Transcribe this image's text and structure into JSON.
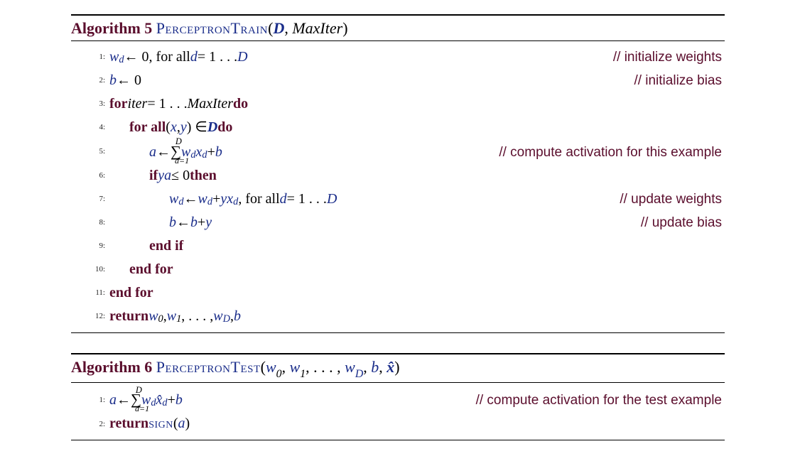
{
  "alg5": {
    "header_label": "Algorithm 5",
    "name": "PerceptronTrain",
    "params_open": "(",
    "param1": "D",
    "params_sep": ", ",
    "param2": "MaxIter",
    "params_close": ")",
    "lines": {
      "l1_no": "1:",
      "l1_code_pre": "w",
      "l1_code_sub": "d",
      "l1_code_mid": " ← 0, for all  ",
      "l1_code_d": "d",
      "l1_code_eq": " = 1 . . . ",
      "l1_code_D": "D",
      "l1_comment": "// initialize weights",
      "l2_no": "2:",
      "l2_code_b": "b",
      "l2_code_rest": " ← 0",
      "l2_comment": "// initialize bias",
      "l3_no": "3:",
      "l3_for": "for",
      "l3_iter": " iter",
      "l3_eq": " = 1 . . . ",
      "l3_maxiter": "MaxIter",
      "l3_do": " do",
      "l4_no": "4:",
      "l4_forall": "for all",
      "l4_open": " (",
      "l4_x": "x",
      "l4_comma": ",",
      "l4_y": "y",
      "l4_close": ") ∈ ",
      "l4_D": "D",
      "l4_do": " do",
      "l5_no": "5:",
      "l5_a": "a",
      "l5_arrow": " ← ",
      "l5_sum_top": "D",
      "l5_sum_bot": "d=1",
      "l5_w": " w",
      "l5_wd": "d",
      "l5_sp": " ",
      "l5_x": "x",
      "l5_xd": "d",
      "l5_plus": " + ",
      "l5_b": "b",
      "l5_comment": "// compute activation for this example",
      "l6_no": "6:",
      "l6_if": "if",
      "l6_ya": " ya",
      "l6_le": " ≤ 0 ",
      "l6_then": "then",
      "l7_no": "7:",
      "l7_w1": "w",
      "l7_d1": "d",
      "l7_arrow": " ← ",
      "l7_w2": "w",
      "l7_d2": "d",
      "l7_plus": " + ",
      "l7_yx": "yx",
      "l7_d3": "d",
      "l7_forall": ", for all  ",
      "l7_d": "d",
      "l7_eq": " = 1 . . . ",
      "l7_D": "D",
      "l7_comment": "// update weights",
      "l8_no": "8:",
      "l8_b1": "b",
      "l8_arrow": " ← ",
      "l8_b2": "b",
      "l8_plus": " + ",
      "l8_y": "y",
      "l8_comment": "// update bias",
      "l9_no": "9:",
      "l9_endif": "end if",
      "l10_no": "10:",
      "l10_endfor": "end for",
      "l11_no": "11:",
      "l11_endfor": "end for",
      "l12_no": "12:",
      "l12_return": "return",
      "l12_sp": "  ",
      "l12_w0": "w",
      "l12_0": "0",
      "l12_c1": ", ",
      "l12_w1": "w",
      "l12_1": "1",
      "l12_c2": ", . . . , ",
      "l12_wD": "w",
      "l12_D": "D",
      "l12_c3": ", ",
      "l12_b": "b"
    }
  },
  "alg6": {
    "header_label": "Algorithm 6",
    "name": "PerceptronTest",
    "params_open": "(",
    "p_w0": "w",
    "p_0": "0",
    "p_c1": ", ",
    "p_w1": "w",
    "p_1": "1",
    "p_c2": ", . . . , ",
    "p_wD": "w",
    "p_D": "D",
    "p_c3": ", ",
    "p_b": "b",
    "p_c4": ", ",
    "p_xhat": "x̂",
    "params_close": ")",
    "lines": {
      "l1_no": "1:",
      "l1_a": "a",
      "l1_arrow": " ← ",
      "l1_sum_top": "D",
      "l1_sum_bot": "d=1",
      "l1_w": " w",
      "l1_wd": "d",
      "l1_sp": " ",
      "l1_x": "x̂",
      "l1_xd": "d",
      "l1_plus": " + ",
      "l1_b": "b",
      "l1_comment": "// compute activation for the test example",
      "l2_no": "2:",
      "l2_return": "return",
      "l2_sp": "  ",
      "l2_sign": "sign",
      "l2_open": "(",
      "l2_a": "a",
      "l2_close": ")"
    }
  }
}
